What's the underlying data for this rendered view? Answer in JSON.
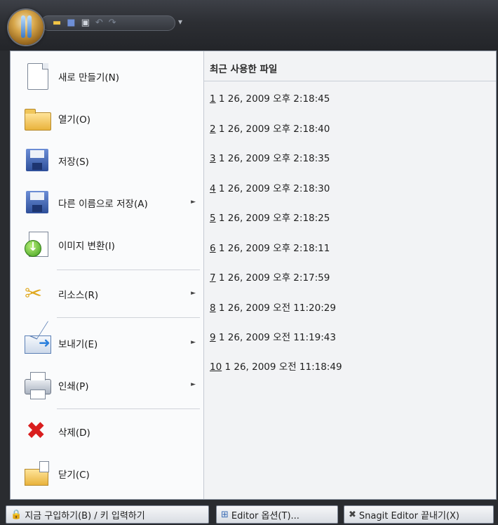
{
  "quick_access": {
    "icons": [
      "open-icon",
      "save-icon",
      "print-icon",
      "undo-icon",
      "redo-icon"
    ],
    "customize_glyph": "▾"
  },
  "menu": {
    "items": [
      {
        "label": "새로 만들기(N)",
        "icon": "new-document-icon"
      },
      {
        "label": "열기(O)",
        "icon": "open-folder-icon"
      },
      {
        "label": "저장(S)",
        "icon": "save-disk-icon"
      },
      {
        "label": "다른 이름으로 저장(A)",
        "icon": "save-as-icon",
        "submenu": true
      },
      {
        "label": "이미지 변환(I)",
        "icon": "convert-image-icon"
      },
      {
        "label": "리소스(R)",
        "icon": "resources-tools-icon",
        "submenu": true
      },
      {
        "label": "보내기(E)",
        "icon": "send-envelope-icon",
        "submenu": true
      },
      {
        "label": "인쇄(P)",
        "icon": "printer-icon",
        "submenu": true
      },
      {
        "label": "삭제(D)",
        "icon": "delete-x-icon"
      },
      {
        "label": "닫기(C)",
        "icon": "close-folder-icon"
      }
    ],
    "submenu_arrow": "►"
  },
  "recent": {
    "title": "최근 사용한 파일",
    "files": [
      {
        "num": "1",
        "text": " 1 26, 2009 오후 2:18:45"
      },
      {
        "num": "2",
        "text": " 1 26, 2009 오후 2:18:40"
      },
      {
        "num": "3",
        "text": " 1 26, 2009 오후 2:18:35"
      },
      {
        "num": "4",
        "text": " 1 26, 2009 오후 2:18:30"
      },
      {
        "num": "5",
        "text": " 1 26, 2009 오후 2:18:25"
      },
      {
        "num": "6",
        "text": " 1 26, 2009 오후 2:18:11"
      },
      {
        "num": "7",
        "text": " 1 26, 2009 오후 2:17:59"
      },
      {
        "num": "8",
        "text": " 1 26, 2009 오전 11:20:29"
      },
      {
        "num": "9",
        "text": " 1 26, 2009 오전 11:19:43"
      },
      {
        "num": "10",
        "text": " 1 26, 2009 오전 11:18:49"
      }
    ]
  },
  "footer": {
    "buy_label": "지금 구입하기(B) / 키 입력하기",
    "options_label": "Editor 옵션(T)...",
    "exit_label": "Snagit Editor 끝내기(X)"
  }
}
